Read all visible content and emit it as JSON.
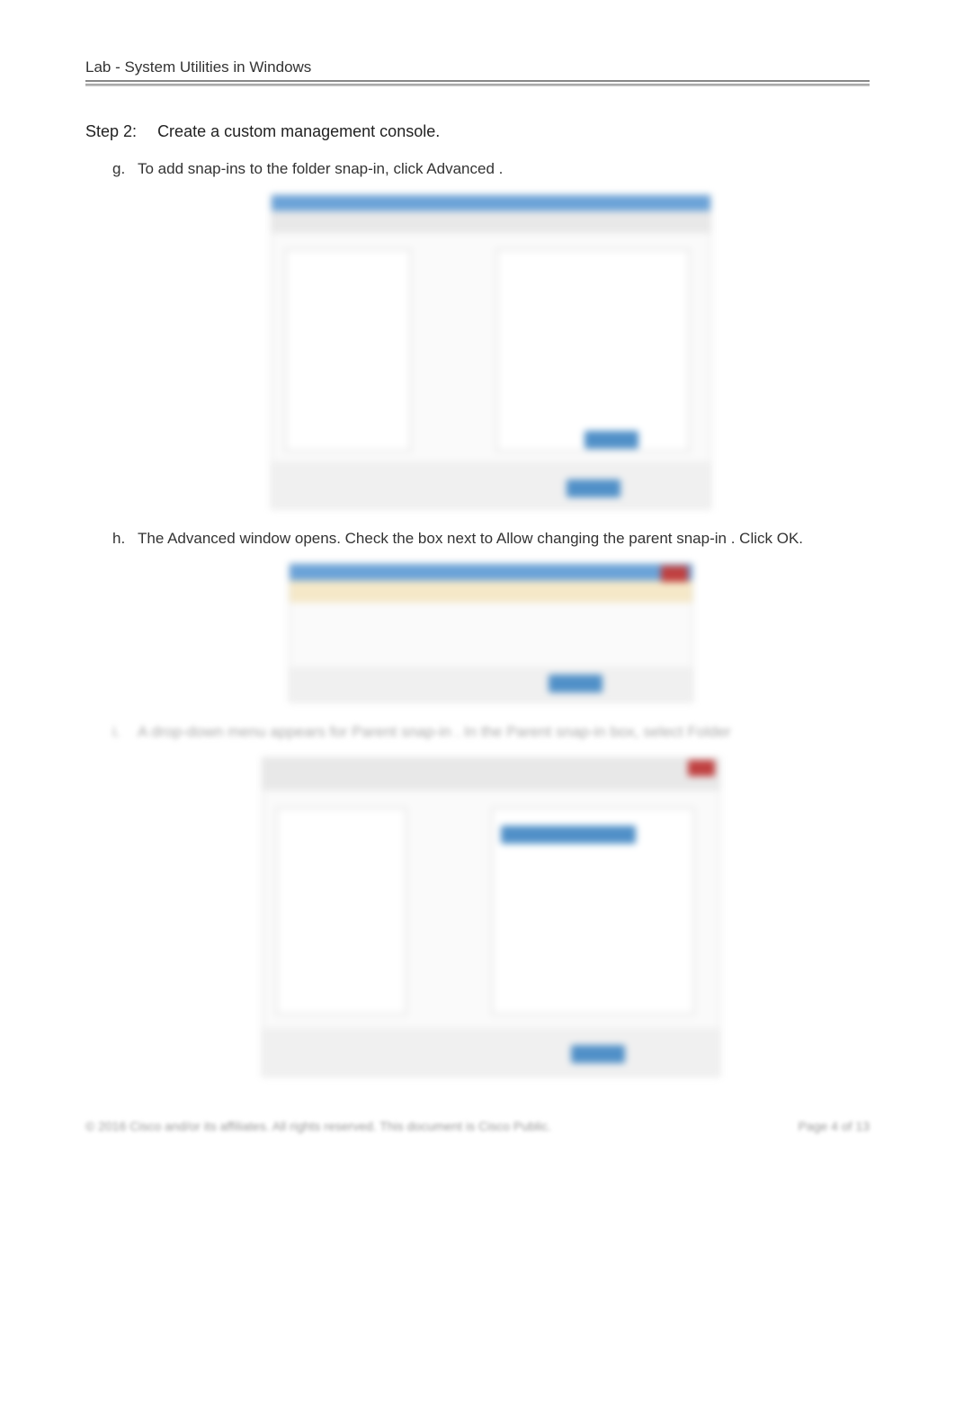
{
  "header": {
    "title": "Lab - System Utilities in Windows"
  },
  "step": {
    "label": "Step 2:",
    "title": "Create a custom management console."
  },
  "items": {
    "g": {
      "letter": "g.",
      "text_1": "To add snap-ins to the folder snap-in, click ",
      "text_2": "Advanced",
      "text_3": "."
    },
    "h": {
      "letter": "h.",
      "text_1": "The ",
      "text_2": "Advanced",
      "text_3": " window opens. Check the ",
      "text_4": "box next to ",
      "text_5": "Allow changing the parent snap-in",
      "text_6": ". Click OK."
    },
    "i": {
      "letter": "i.",
      "text_1": "A drop-down menu appears for",
      "text_2": "Parent snap-in",
      "text_3": ". In the",
      "text_4": "Parent snap-in",
      "text_5": "box, select",
      "text_6": "Folder"
    }
  },
  "footer": {
    "copyright": "© 2016 Cisco and/or its affiliates. All rights reserved. This document is Cisco Public.",
    "page": "Page 4 of 13"
  }
}
